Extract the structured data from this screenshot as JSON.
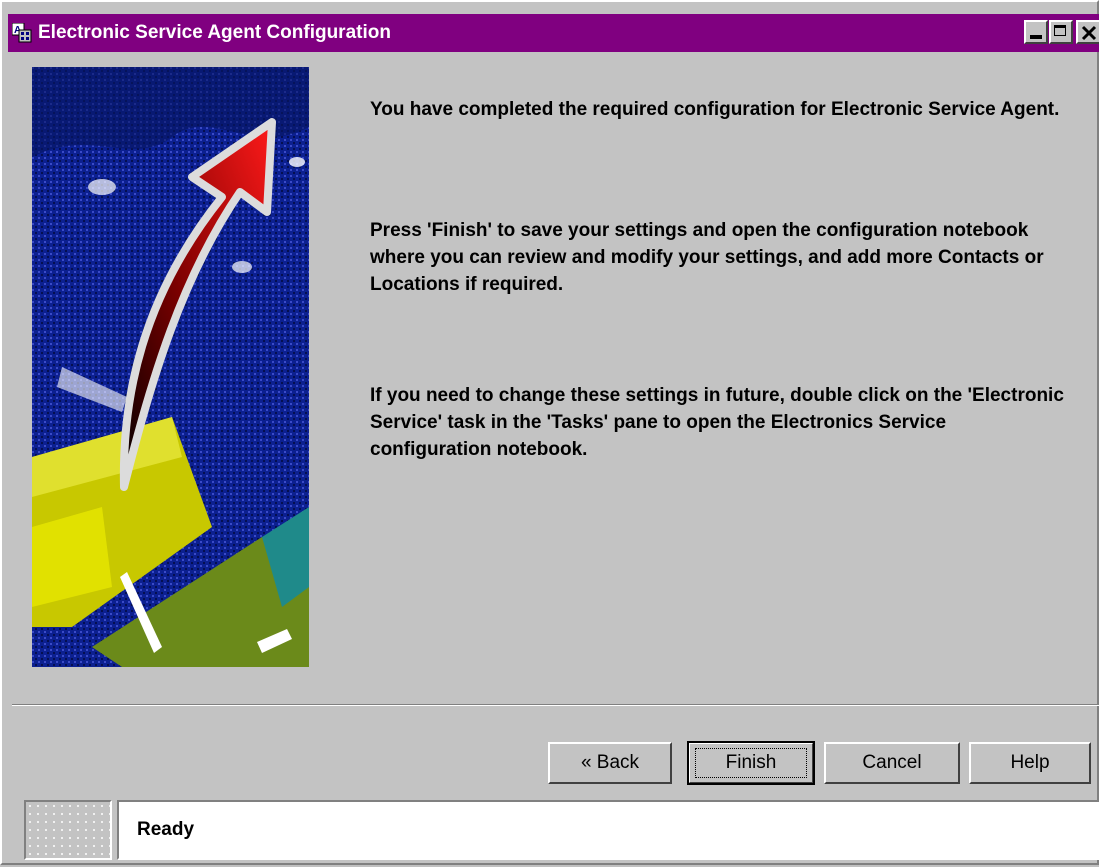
{
  "window": {
    "title": "Electronic Service Agent Configuration"
  },
  "content": {
    "message_1": "You have completed the required configuration for Electronic Service Agent.",
    "message_2": "Press 'Finish' to save your settings and open the configuration notebook where you can review and modify your settings, and add more Contacts or Locations if required.",
    "message_3": "If you need to change these settings in future, double click on the 'Electronic Service' task in the 'Tasks' pane to open the Electronics Service configuration notebook."
  },
  "buttons": {
    "back": "« Back",
    "finish": "Finish",
    "cancel": "Cancel",
    "help": "Help"
  },
  "status": {
    "text": "Ready"
  },
  "colors": {
    "titlebar": "#800080",
    "dialog_background": "#c3c3c3",
    "illustration_background": "#0a1e96",
    "arrow": "#e80000"
  },
  "icons": {
    "title": "app-window-icon",
    "minimize": "minimize-icon",
    "maximize": "maximize-icon",
    "close": "close-icon"
  }
}
